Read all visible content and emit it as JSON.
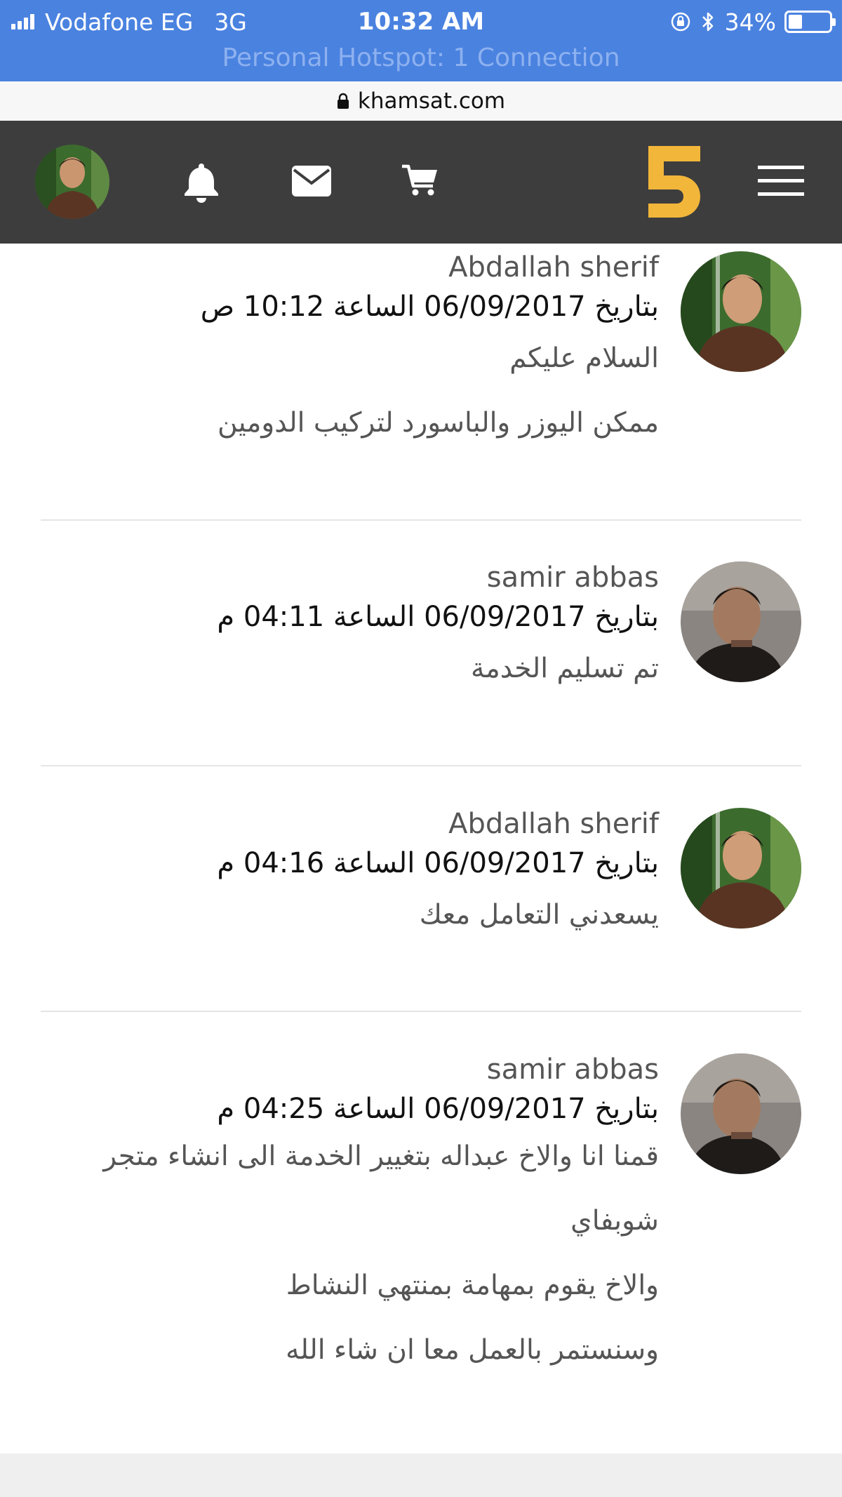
{
  "status_bar": {
    "carrier": "Vodafone EG",
    "network": "3G",
    "time": "10:32 AM",
    "battery_percent": "34%",
    "battery_level": 0.34,
    "hotspot_text": "Personal Hotspot: 1 Connection"
  },
  "url_bar": {
    "domain": "khamsat.com"
  },
  "header": {
    "icons": [
      "bell-icon",
      "mail-icon",
      "cart-icon",
      "khamsat-logo",
      "menu-icon"
    ],
    "logo_color": "#f2b63a",
    "background": "#3d3d3d"
  },
  "messages": [
    {
      "author": "Abdallah sherif",
      "date": "بتاريخ 06/09/2017 الساعة 10:12 ص",
      "lines": [
        "السلام عليكم",
        "ممكن اليوزر والباسورد لتركيب الدومين"
      ]
    },
    {
      "author": "samir abbas",
      "date": "بتاريخ 06/09/2017 الساعة 04:11 م",
      "lines": [
        "تم تسليم الخدمة"
      ]
    },
    {
      "author": "Abdallah sherif",
      "date": "بتاريخ 06/09/2017 الساعة 04:16 م",
      "lines": [
        "يسعدني التعامل معك"
      ]
    },
    {
      "author": "samir abbas",
      "date": "بتاريخ 06/09/2017 الساعة 04:25 م",
      "lines": [
        "قمنا انا والاخ عبداله بتغيير الخدمة الى انشاء متجر",
        "شوبفاي",
        "والاخ يقوم بمهامة بمنتهي النشاط",
        "وسنستمر بالعمل معا ان شاء الله"
      ]
    }
  ]
}
